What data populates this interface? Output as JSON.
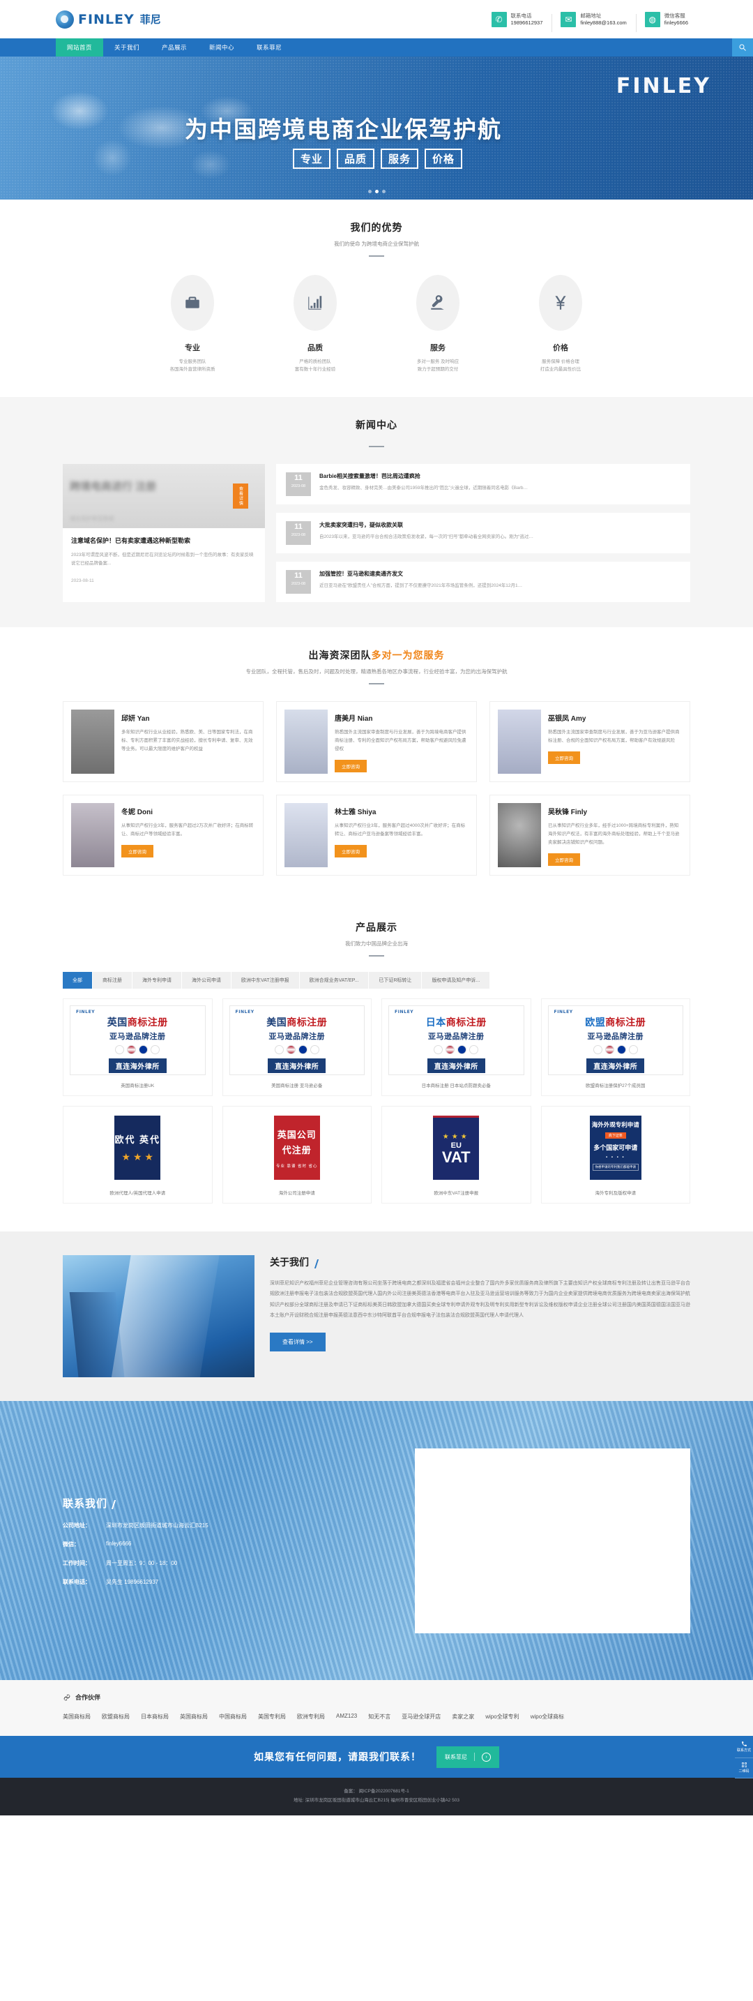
{
  "header": {
    "brand_text": "FINLEY",
    "brand_cn": "菲尼",
    "contacts": [
      {
        "icon": "phone-icon",
        "label": "联系电话",
        "value": "19896612937"
      },
      {
        "icon": "mail-icon",
        "label": "邮箱地址",
        "value": "finley888@163.com"
      },
      {
        "icon": "wechat-icon",
        "label": "微信客服",
        "value": "finley6666"
      }
    ]
  },
  "nav": {
    "items": [
      {
        "label": "网站首页",
        "active": true
      },
      {
        "label": "关于我们",
        "active": false
      },
      {
        "label": "产品展示",
        "active": false
      },
      {
        "label": "新闻中心",
        "active": false
      },
      {
        "label": "联系菲尼",
        "active": false
      }
    ],
    "search_icon": "search-icon"
  },
  "banner": {
    "watermark": "FINLEY",
    "headline": "为中国跨境电商企业保驾护航",
    "badges": [
      "专业",
      "品质",
      "服务",
      "价格"
    ],
    "slide_count": 3,
    "active_slide": 1
  },
  "advantages": {
    "title": "我们的优势",
    "subtitle": "我们的使命 为跨境电商企业保驾护航",
    "items": [
      {
        "icon": "briefcase-icon",
        "title": "专业",
        "desc_line1": "专业服务团队",
        "desc_line2": "各国海外直营律所资质"
      },
      {
        "icon": "chart-growth-icon",
        "title": "品质",
        "desc_line1": "严格的质检团队",
        "desc_line2": "富有数十年行业经验"
      },
      {
        "icon": "service-hand-icon",
        "title": "服务",
        "desc_line1": "多对一服务 及时响应",
        "desc_line2": "致力于超预期的交付"
      },
      {
        "icon": "yen-icon",
        "title": "价格",
        "desc_line1": "服务保障 价格合理",
        "desc_line2": "打造业内最具性价比"
      }
    ]
  },
  "news": {
    "title": "新闻中心",
    "feature": {
      "badge": "查看详情",
      "image_blur_title": "跨境电商进行 注册",
      "image_blur_sub": "域名保护新型勒索",
      "title": "注意域名保护！已有卖家遭遇这种新型勒索",
      "summary": "2023年可谓是风波不断，但是近期尼尼在浏览论坛的时候看到一个悲伤的故事：有卖家反映说它已经品牌备案...",
      "date": "2023-08-11"
    },
    "items": [
      {
        "day": "11",
        "ym": "2023-08",
        "title": "Barbie相关搜索量激增！芭比周边遭疯抢",
        "summary": "金色秀发、妆容精致、身材完美…由美泰公司1959年推出的“芭比”火遍全球，近期随着同名电影《Barb…"
      },
      {
        "day": "11",
        "ym": "2023-08",
        "title": "大批卖家突遭扫号，疑似收款关联",
        "summary": "自2023年以来，亚马逊的平台合规合法政策愈发收紧，每一次的“扫号”都牵动着全网卖家的心。刚为“逃过…"
      },
      {
        "day": "11",
        "ym": "2023-08",
        "title": "加强管控！亚马逊和速卖通齐发文",
        "summary": "近日亚马逊在“欧盟责任人”合规方面，提到了不仅要遵守2021年市场监管条例，还提到2024年12月1…"
      }
    ]
  },
  "team": {
    "title_plain": "出海资深团队",
    "title_accent": "多对一为您服务",
    "subtitle": "专业团队，全程托管，售后及时，问题及时处理，精通熟悉各地区办事流程，行业经验丰富，为您的出海保驾护航",
    "button_label": "立即咨询",
    "members": [
      {
        "name": "邱妍 Yan",
        "desc": "多年知识产权行业从业经验，熟悉欧、美、日等国家专利法，在商标、专利方面积累了丰富的实战经验，擅长专利申请、复审、无效等业务。可以最大限度的维护客户的权益",
        "photo_tone": "#8d8d8d"
      },
      {
        "name": "唐美月 Nian",
        "desc": "熟悉国外主流国家审查制度与行业发展，善于为跨境电商客户提供商标注册、专利的全面知识产权布局方案，帮助客户规避风险免遭侵权",
        "photo_tone": "#c9d2e4"
      },
      {
        "name": "巫银凤 Amy",
        "desc": "熟悉国外主流国家审查制度与行业发展，善于为亚马逊客户提供商标注册、合规的全面知识产权布局方案，帮助客户有效规避风险",
        "photo_tone": "#c3c9de"
      },
      {
        "name": "冬妮 Doni",
        "desc": "从事知识产权行业3年，服务客户超过2万次并广收好评；在商标转让、商标过户等领域经验丰富。",
        "photo_tone": "#b9b4c2"
      },
      {
        "name": "林士雅 Shiya",
        "desc": "从事知识产权行业3年，服务客户超过4000次并广收好评；在商标转让、商标过户亚马逊备案等领域经验丰富。",
        "photo_tone": "#cfd6e6"
      },
      {
        "name": "吴秋锋 Finly",
        "desc": "已从事知识产权行业多年，经手过1000+跨境商标专利案件，熟知海外知识产权法，有丰富的海外商标处理经验，帮助上千个亚马逊卖家解决店铺知识产权问题。",
        "photo_tone": "#7b7b7b"
      }
    ]
  },
  "products": {
    "title": "产品展示",
    "subtitle": "我们致力中国品牌企业出海",
    "tabs": [
      {
        "label": "全部",
        "active": true
      },
      {
        "label": "商标注册",
        "active": false
      },
      {
        "label": "海外专利申请",
        "active": false
      },
      {
        "label": "海外公司申请",
        "active": false
      },
      {
        "label": "欧洲中东VAT注册申报",
        "active": false
      },
      {
        "label": "欧洲合规业务VAT/EP...",
        "active": false
      },
      {
        "label": "已下证R标转让",
        "active": false
      },
      {
        "label": "版权申请及知产申诉...",
        "active": false
      }
    ],
    "items": [
      {
        "style": "trademark",
        "country": "英国",
        "l1_rest": "商标注册",
        "l2": "亚马逊品牌注册",
        "cta": "直连海外律所",
        "caption": "英国商标注册UK"
      },
      {
        "style": "trademark",
        "country": "美国",
        "l1_rest": "商标注册",
        "l2": "亚马逊品牌注册",
        "cta": "直连海外律所",
        "caption": "美国商标注册 亚马逊必备"
      },
      {
        "style": "trademark",
        "country": "日本",
        "l1_rest": "商标注册",
        "l2": "亚马逊品牌注册",
        "cta": "直连海外律所",
        "caption": "日本商标注册 日本站点防跟卖必备"
      },
      {
        "style": "trademark",
        "country": "欧盟",
        "l1_rest": "商标注册",
        "l2": "亚马逊品牌注册",
        "cta": "直连海外律所",
        "caption": "欧盟商标注册保护27个成员国"
      },
      {
        "style": "navy",
        "line1": "欧代  英代",
        "line2": "",
        "bg": "#152a5e",
        "caption": "欧洲代理人/英国代理人申请"
      },
      {
        "style": "red",
        "line1": "英国公司",
        "line2": "代注册",
        "sub": "专业 靠谱 省时 省心",
        "bg": "#c0242c",
        "caption": "海外公司注册申请"
      },
      {
        "style": "vat",
        "line1": "EU",
        "line2": "VAT",
        "bg": "#1b2a6b",
        "caption": "欧洲中东VAT注册申报"
      },
      {
        "style": "patent",
        "line1": "海外外观专利申请",
        "line2": "多个国家可申请",
        "tagline": "高下证率",
        "footer": "你想申请的专利我们都能申请",
        "bg": "#14316b",
        "caption": "海外专利及版权申请"
      }
    ]
  },
  "about": {
    "title": "关于我们",
    "text": "深圳菲尼知识产权福州菲尼企业管理咨询有限公司坐落于跨境电商之都深圳及福建省会福州企业整合了国内外多家优质服务商及律所旗下主要由知识产权全球商标专利注册及转让出售亚马逊平台合规欧洲注册申报电子法包装法合规欧盟英国代理人国内外公司注册美英德法香港等电商平台入驻及亚马逊运营培训服务等致力于为国内企业卖家提供跨境电商优质服务为跨境电商卖家出海保驾护航知识产权部分全球商标注册及申请已下证商标标美英日韩欧盟加拿大德国买卖全球专利申请外观专利及明专利实用新型专利诉讼及维权版权申请企业注册全球公司注册国内美国英国德国法国亚马逊本土账户开设财税合规注册申报英德法意西中东沙特阿联酋平台合规申报电子法包装法合规欧盟英国代理人申请代理人",
    "button_label": "查看详情 >>"
  },
  "contact_section": {
    "title": "联系我们",
    "rows": [
      {
        "key": "公司地址：",
        "value": "深圳市龙岗区坂田街道城市山海云汇B215"
      },
      {
        "key": "微信：",
        "value": "finley6666"
      },
      {
        "key": "工作时间：",
        "value": "周一至周五：9：00 - 18：00"
      },
      {
        "key": "联系电话：",
        "value": "吴先生 19896612937"
      }
    ]
  },
  "partners": {
    "title": "合作伙伴",
    "icon": "link-icon",
    "items": [
      "美国商标局",
      "欧盟商标局",
      "日本商标局",
      "英国商标局",
      "中国商标局",
      "美国专利局",
      "欧洲专利局",
      "AMZ123",
      "知无不言",
      "亚马逊全球开店",
      "卖家之家",
      "wipo全球专利",
      "wipo全球商标"
    ]
  },
  "cta": {
    "text": "如果您有任何问题，请跟我们联系！",
    "button_label": "联系菲尼",
    "button_icon": "arrow-right-icon"
  },
  "footer": {
    "line1": "备案： 闽ICP备2022007681号-1",
    "line2": "地址: 深圳市龙岗区坂田街道城市山海云汇B215| 福州市晋安区稻田创业小镇A2 503"
  },
  "dock": {
    "items": [
      {
        "icon": "phone-icon",
        "label": "联系方式"
      },
      {
        "icon": "qrcode-icon",
        "label": "二维码"
      }
    ]
  },
  "colors": {
    "primary": "#2272c0",
    "accent_teal": "#21b99b",
    "accent_orange": "#f2921c",
    "navy": "#1b3e77",
    "red": "#c0242c"
  }
}
